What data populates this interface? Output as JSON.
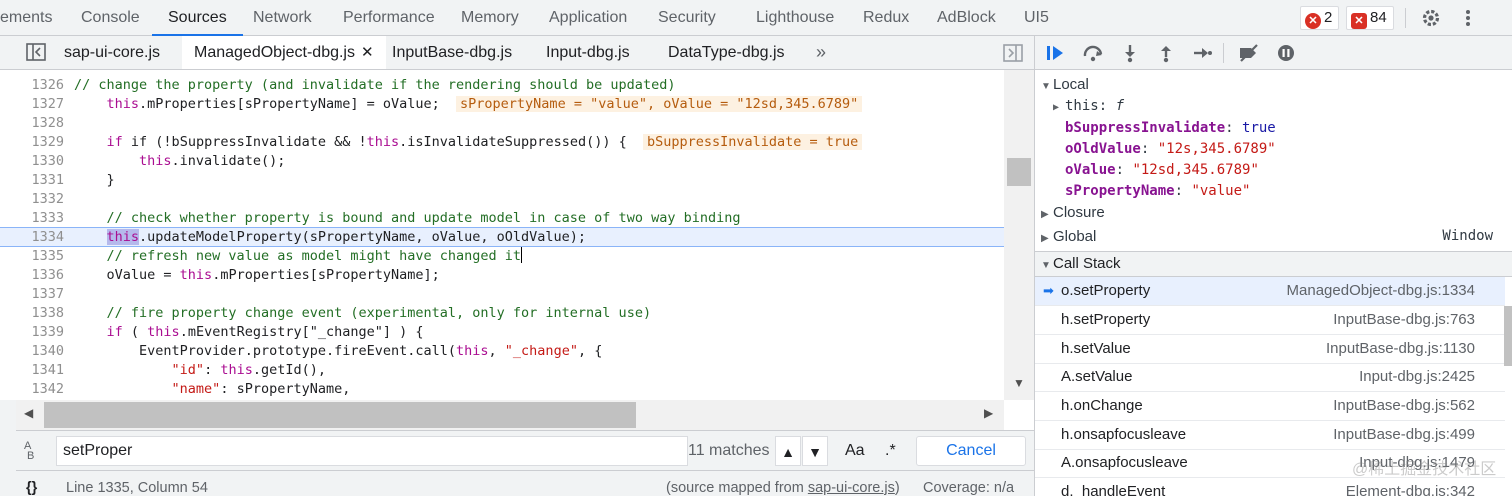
{
  "main_tabs": [
    {
      "label": "ements"
    },
    {
      "label": "Console"
    },
    {
      "label": "Sources"
    },
    {
      "label": "Network"
    },
    {
      "label": "Performance"
    },
    {
      "label": "Memory"
    },
    {
      "label": "Application"
    },
    {
      "label": "Security"
    },
    {
      "label": "Lighthouse"
    },
    {
      "label": "Redux"
    },
    {
      "label": "AdBlock"
    },
    {
      "label": "UI5"
    }
  ],
  "badges": {
    "errors": "2",
    "warnings": "84",
    "error_color": "#d93025"
  },
  "icons": {
    "settings": "gear-icon",
    "more": "vertical-dots-icon",
    "x_glyph": "✕"
  },
  "file_tabs": [
    {
      "label": "sap-ui-core.js"
    },
    {
      "label": "ManagedObject-dbg.js"
    },
    {
      "label": "InputBase-dbg.js"
    },
    {
      "label": "Input-dbg.js"
    },
    {
      "label": "DataType-dbg.js"
    }
  ],
  "file_tabs_overflow": "»",
  "code": {
    "current_line": "1334",
    "lines": [
      {
        "n": "1326"
      },
      {
        "n": "1327",
        "inline": "sPropertyName = \"value\", oValue = \"12sd,345.6789\""
      },
      {
        "n": "1328"
      },
      {
        "n": "1329",
        "inline": "bSuppressInvalidate = true"
      },
      {
        "n": "1330"
      },
      {
        "n": "1331"
      },
      {
        "n": "1332"
      },
      {
        "n": "1333"
      },
      {
        "n": "1334"
      },
      {
        "n": "1335"
      },
      {
        "n": "1336"
      },
      {
        "n": "1337"
      },
      {
        "n": "1338"
      },
      {
        "n": "1339"
      },
      {
        "n": "1340"
      },
      {
        "n": "1341"
      },
      {
        "n": "1342"
      }
    ],
    "text": {
      "l1326": "// change the property (and invalidate if the rendering should be updated)",
      "l1327a": "this",
      "l1327b": ".mProperties[sPropertyName] = oValue;",
      "l1329a": "if (!bSuppressInvalidate && !",
      "l1329b": "this",
      "l1329c": ".isInvalidateSuppressed()) {",
      "l1330a": "this",
      "l1330b": ".invalidate();",
      "l1331": "}",
      "l1333": "// check whether property is bound and update model in case of two way binding",
      "l1334a": "this",
      "l1334b": ".updateModelProperty(sPropertyName, oValue, oOldValue);",
      "l1335": "// refresh new value as model might have changed it",
      "l1336a": "oValue = ",
      "l1336b": "this",
      "l1336c": ".mProperties[sPropertyName];",
      "l1338": "// fire property change event (experimental, only for internal use)",
      "l1339a": "if",
      "l1339b": " ( ",
      "l1339c": "this",
      "l1339d": ".mEventRegistry[\"_change\"] ) {",
      "l1340a": "EventProvider.prototype.fireEvent.call(",
      "l1340b": "this",
      "l1340c": ", ",
      "l1340d": "\"_change\"",
      "l1340e": ", {",
      "l1341a": "\"id\"",
      "l1341b": ": ",
      "l1341c": "this",
      "l1341d": ".getId(),",
      "l1342a": "\"name\"",
      "l1342b": ": sPropertyName,"
    }
  },
  "search": {
    "query": "setProper",
    "matches": "11 matches",
    "case_label": "Aa",
    "regex_label": ".*",
    "prev": "▲",
    "next": "▼",
    "cancel": "Cancel"
  },
  "status": {
    "braces": "{}",
    "position": "Line 1335, Column 54",
    "source_map_prefix": "(source mapped from ",
    "source_map_file": "sap-ui-core.js",
    "source_map_suffix": ")",
    "coverage": "Coverage: n/a"
  },
  "scope": {
    "local_label": "Local",
    "this_label": "this",
    "this_value": "f",
    "vars": [
      {
        "name": "bSuppressInvalidate",
        "value": "true",
        "kind": "kw"
      },
      {
        "name": "oOldValue",
        "value": "\"12s,345.6789\"",
        "kind": "str"
      },
      {
        "name": "oValue",
        "value": "\"12sd,345.6789\"",
        "kind": "str"
      },
      {
        "name": "sPropertyName",
        "value": "\"value\"",
        "kind": "str"
      }
    ],
    "closure_label": "Closure",
    "global_label": "Global",
    "global_value": "Window"
  },
  "call_stack": {
    "label": "Call Stack",
    "frames": [
      {
        "fn": "o.setProperty",
        "loc": "ManagedObject-dbg.js:1334"
      },
      {
        "fn": "h.setProperty",
        "loc": "InputBase-dbg.js:763"
      },
      {
        "fn": "h.setValue",
        "loc": "InputBase-dbg.js:1130"
      },
      {
        "fn": "A.setValue",
        "loc": "Input-dbg.js:2425"
      },
      {
        "fn": "h.onChange",
        "loc": "InputBase-dbg.js:562"
      },
      {
        "fn": "h.onsapfocusleave",
        "loc": "InputBase-dbg.js:499"
      },
      {
        "fn": "A.onsapfocusleave",
        "loc": "Input-dbg.js:1479"
      },
      {
        "fn": "d._handleEvent",
        "loc": "Element-dbg.js:342"
      }
    ]
  },
  "watermark": "@稀土掘金技术社区"
}
